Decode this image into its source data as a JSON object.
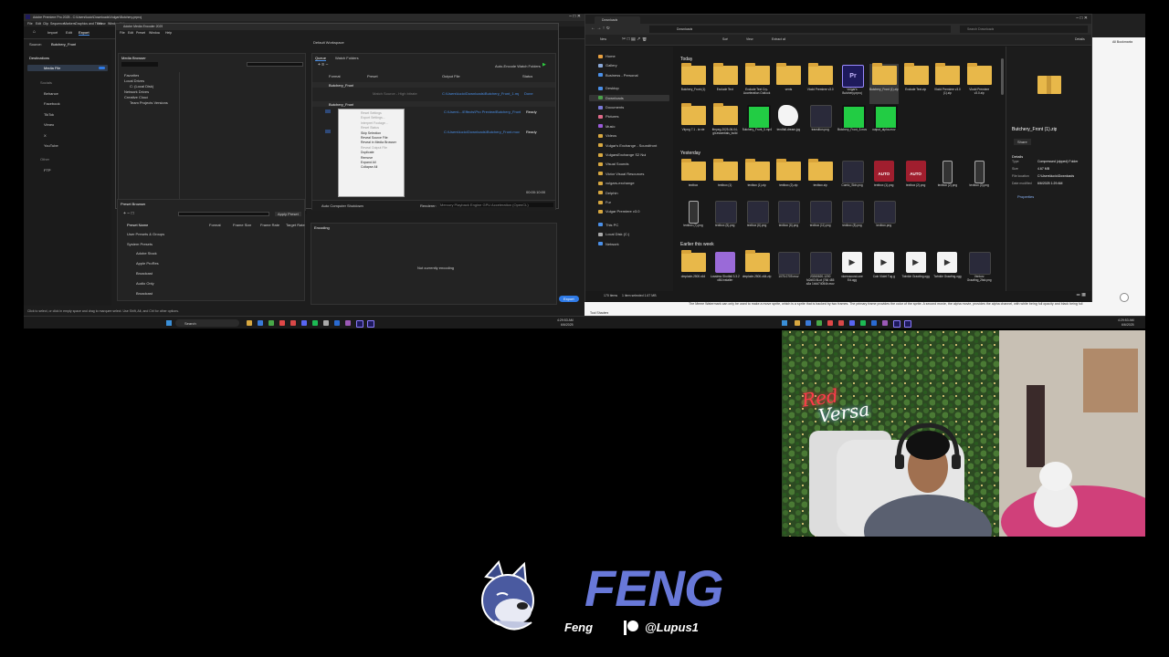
{
  "left": {
    "window_title": "Adobe Premiere Pro 2025 - C:\\Users\\lucio\\Downloads\\Vulgar\\Butchery.prproj",
    "menu": [
      "File",
      "Edit",
      "Clip",
      "Sequence",
      "Markers",
      "Graphics and Titles",
      "View",
      "Window",
      "Help"
    ],
    "header_tabs": {
      "home": "Import",
      "edit": "Edit",
      "export": "Export"
    },
    "source_label": "Source:",
    "source_value": "Butchery_Front",
    "destinations_title": "Destinations",
    "media_file": "Media File",
    "socials_title": "Socials",
    "socials": [
      "Behance",
      "Facebook",
      "TikTok",
      "Vimeo",
      "X",
      "YouTube"
    ],
    "other_title": "Other",
    "ftp": "FTP",
    "dialog": {
      "title": "Adobe Media Encoder 2025",
      "menu": [
        "File",
        "Edit",
        "Preset",
        "Window",
        "Help"
      ],
      "media_browser": "Media Browser",
      "tree": [
        "Favorites",
        "Local Drives",
        "C: (Local Disk)",
        "Network Drives",
        "Creative Cloud",
        "Team Projects Versions"
      ],
      "workspace": "Default Workspace",
      "queue_tab": "Queue",
      "watch_tab": "Watch Folders",
      "auto_encode": "Auto-Encode Watch Folders",
      "col_format": "Format",
      "col_preset": "Preset",
      "col_output": "Output File",
      "col_status": "Status",
      "row1": "Butchery_Front",
      "row1_preset": "Match Source - High bitrate",
      "row1_out": "C:\\Users\\lucio\\Downloads\\Butchery_Front_1.mp4",
      "row1_status": "Done",
      "row2": "Butchery_Front",
      "row2_out": "C:\\Users\\...\\Effects\\Pro Preview\\Butchery_Front.mov",
      "row2_status": "Ready",
      "row3_out": "C:\\Users\\lucio\\Downloads\\Butchery_Front.mov",
      "row3_status": "Ready",
      "context_menu": [
        {
          "label": "Reset Settings",
          "disabled": true
        },
        {
          "label": "Export Settings...",
          "disabled": true
        },
        {
          "label": "Interpret Footage...",
          "disabled": true
        },
        {
          "label": "Reset Status",
          "disabled": true
        },
        {
          "label": "Skip Selection",
          "disabled": false
        },
        {
          "label": "Reveal Source File",
          "disabled": false
        },
        {
          "label": "Reveal in Media Browser",
          "disabled": false
        },
        {
          "label": "Reveal Output File",
          "disabled": true
        },
        {
          "label": "Duplicate",
          "disabled": false
        },
        {
          "label": "Remove",
          "disabled": false
        },
        {
          "label": "Expand All",
          "disabled": false
        },
        {
          "label": "Collapse All",
          "disabled": false
        }
      ],
      "auto_computer": "Auto Computer Shutdown",
      "renderer_label": "Renderer:",
      "renderer_value": "Mercury Playback Engine GPU Acceleration (OpenCL)",
      "preset_browser": "Preset Browser",
      "apply_preset": "Apply Preset",
      "pb_cols": [
        "Preset Name",
        "Format",
        "Frame Size",
        "Frame Rate",
        "Target Rate"
      ],
      "pb_items": [
        "User Presets & Groups",
        "System Presets",
        "Adobe Stock",
        "Apple ProRes",
        "Broadcast",
        "Audio Only",
        "Broadcast"
      ],
      "encoding_tab": "Encoding",
      "not_encoding": "Not currently encoding",
      "time": "00:00:10:00"
    },
    "export_button": "Export",
    "status_hint": "Click to select, or click in empty space and drag to marquee select. Use Shift, Alt, and Ctrl for other options.",
    "taskbar_search": "Search",
    "clock_time": "4:29:53 AM",
    "clock_date": "6/6/2025"
  },
  "right": {
    "explorer_title": "Downloads",
    "new_button": "New",
    "sort_button": "Sort",
    "view_button": "View",
    "extract_button": "Extract all",
    "details_button": "Details",
    "address": "Downloads",
    "search_placeholder": "Search Downloads",
    "bookmarks": "All Bookmarks",
    "sidebar": [
      "Home",
      "Gallery",
      "Business - Personal",
      "Desktop",
      "Downloads",
      "Documents",
      "Pictures",
      "Music",
      "Videos",
      "Vulgar's Exchange - Soundfront",
      "VulgarsExchange S2 Nui",
      "Visual Sounds",
      "Victor Visual Resources",
      "vulgars-exchange",
      "Delphin",
      "Fur",
      "Vulgar Premiere v3.0",
      "This PC",
      "Local Disk (C:)",
      "Network"
    ],
    "group_today": "Today",
    "group_yesterday": "Yesterday",
    "group_earlier": "Earlier this week",
    "today_files": [
      {
        "name": "Butchery_Front (1)",
        "kind": "folder"
      },
      {
        "name": "Exclude Text",
        "kind": "folder"
      },
      {
        "name": "Exclude Text Cry-Acceleration Outlook",
        "kind": "folder"
      },
      {
        "name": "vents",
        "kind": "folder"
      },
      {
        "name": "Vlodd Premiere v3.0",
        "kind": "folder"
      },
      {
        "name": "Vulgar's Butchery.prproj",
        "kind": "prproj"
      },
      {
        "name": "Butchery_Front (1).zip",
        "kind": "folder-zip"
      },
      {
        "name": "Exclude Text.zip",
        "kind": "folder"
      },
      {
        "name": "Vlodd Premiere v3.0 (1).zip",
        "kind": "folder"
      },
      {
        "name": "Vlodd Premiere v3.0.zip",
        "kind": "folder"
      },
      {
        "name": "Vlrpng 7.1 - la vie",
        "kind": "folder"
      },
      {
        "name": "ffmpeg-2025-06-04-git-essentials_build",
        "kind": "folder"
      },
      {
        "name": "Butchery_Front_5.mp4",
        "kind": "green"
      },
      {
        "name": "tendfall-dream.jpg",
        "kind": "white"
      },
      {
        "name": "transition.png",
        "kind": "dark"
      },
      {
        "name": "Butchery_Front_5.mov",
        "kind": "green"
      },
      {
        "name": "output_alpha.mov",
        "kind": "green"
      }
    ],
    "yesterday_files": [
      {
        "name": "textbox",
        "kind": "folder"
      },
      {
        "name": "textbox (1)",
        "kind": "folder"
      },
      {
        "name": "textbox (1).zip",
        "kind": "folder"
      },
      {
        "name": "textbox (2).zip",
        "kind": "folder"
      },
      {
        "name": "textbox.zip",
        "kind": "folder"
      },
      {
        "name": "Comic_Skin.png",
        "kind": "dark"
      },
      {
        "name": "textbox (1).png",
        "kind": "auto"
      },
      {
        "name": "textbox (2).png",
        "kind": "auto"
      },
      {
        "name": "textbox (2).png",
        "kind": "phone"
      },
      {
        "name": "textbox (3).png",
        "kind": "phone"
      },
      {
        "name": "textbox (7).png",
        "kind": "phone"
      },
      {
        "name": "textbox (5).png",
        "kind": "dark"
      },
      {
        "name": "textbox (6).png",
        "kind": "dark"
      },
      {
        "name": "textbox (6).png",
        "kind": "dark"
      },
      {
        "name": "textbox (11).png",
        "kind": "dark"
      },
      {
        "name": "textbox (8).png",
        "kind": "dark"
      },
      {
        "name": "textbox.png",
        "kind": "dark"
      }
    ],
    "earlier_files": [
      {
        "name": "dmplode-2500.x64",
        "kind": "folder"
      },
      {
        "name": "Lossless Shotfall 3.3.2 x86.Installer",
        "kind": "rar"
      },
      {
        "name": "dmplode-2500-x64.zip",
        "kind": "folder"
      },
      {
        "name": "1075-0709.mov",
        "kind": "dark"
      },
      {
        "name": "20260620-1200 fd2d03 8Lot (766 485 a3a 1b4d74054b.mov",
        "kind": "dark"
      },
      {
        "name": "vlcerosound-one Ed.ogg",
        "kind": "audio"
      },
      {
        "name": "Coin Violet Tug g",
        "kind": "audio"
      },
      {
        "name": "Twinkle Grawling.ogg",
        "kind": "audio"
      },
      {
        "name": "Twinkle Grawling.ogg",
        "kind": "audio"
      },
      {
        "name": "Venturz Grawling_2fab.png",
        "kind": "dark"
      }
    ],
    "status_count": "170 items",
    "status_selected": "1 item selected  1.67 MB",
    "details_name": "Butchery_Front (1).zip",
    "details_share": "Share",
    "details_heading": "Details",
    "details": [
      {
        "k": "Type",
        "v": "Compressed (zipped) Folder"
      },
      {
        "k": "Size",
        "v": "4.67 MB"
      },
      {
        "k": "File location",
        "v": "C:\\Users\\lucio\\Downloads"
      },
      {
        "k": "Date modified",
        "v": "6/6/2025 1:29 AM"
      }
    ],
    "properties": "Properties",
    "background_text": "The Meme Watermark can only be used to make a move sprite, which is a sprite that is backed by two frames. The primary frame provides the color of the sprite. A second movie, the alpha movie, provides the alpha channel, with white being full opacity and black being full",
    "tool_shaders": "Tool Shaders",
    "clock_time": "4:29:53 AM",
    "clock_date": "6/6/2025"
  },
  "overlay": {
    "neon_line1": "Red",
    "neon_line2": "Versa",
    "brand_title": "FENG",
    "handle_name": "Feng",
    "handle_social": "@Lupus1"
  },
  "colors": {
    "accent": "#6878d8",
    "folder": "#e8b84a",
    "premiere": "#1e1a5c",
    "neon_red": "#ff3a4a"
  }
}
